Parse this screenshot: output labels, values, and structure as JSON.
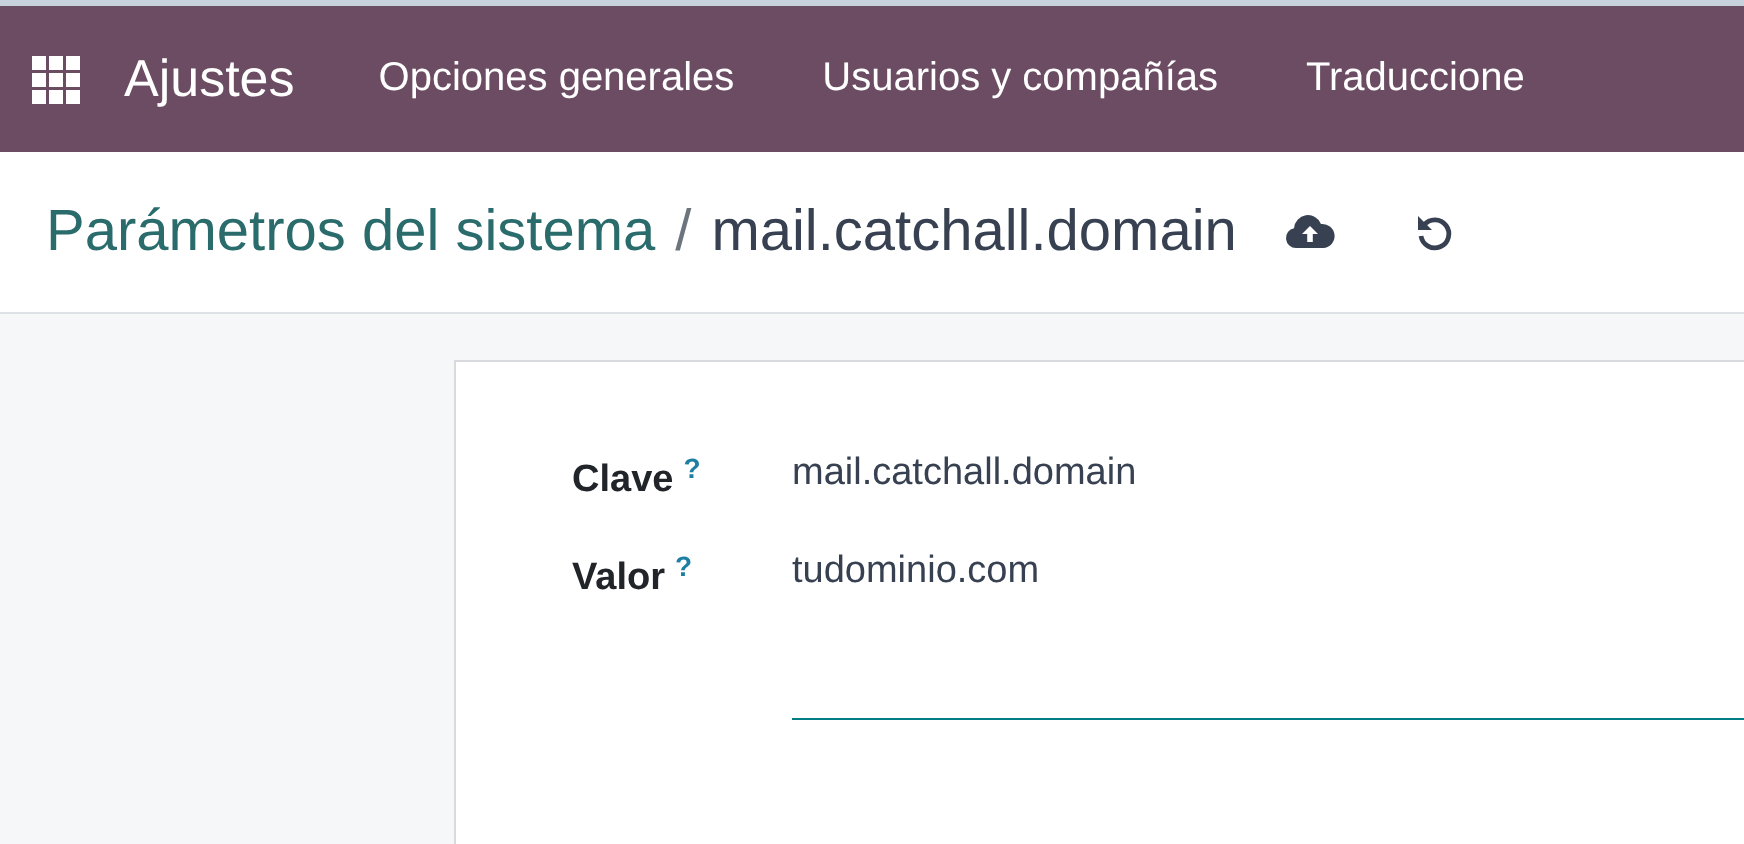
{
  "navbar": {
    "app_name": "Ajustes",
    "menu": [
      {
        "label": "Opciones generales"
      },
      {
        "label": "Usuarios y compañías"
      },
      {
        "label": "Traduccione"
      }
    ]
  },
  "breadcrumb": {
    "parent": "Parámetros del sistema",
    "separator": "/",
    "current": "mail.catchall.domain"
  },
  "form": {
    "fields": [
      {
        "label": "Clave",
        "help": "?",
        "value": "mail.catchall.domain",
        "kind": "text"
      },
      {
        "label": "Valor",
        "help": "?",
        "value": "tudominio.com",
        "kind": "textarea"
      }
    ]
  }
}
